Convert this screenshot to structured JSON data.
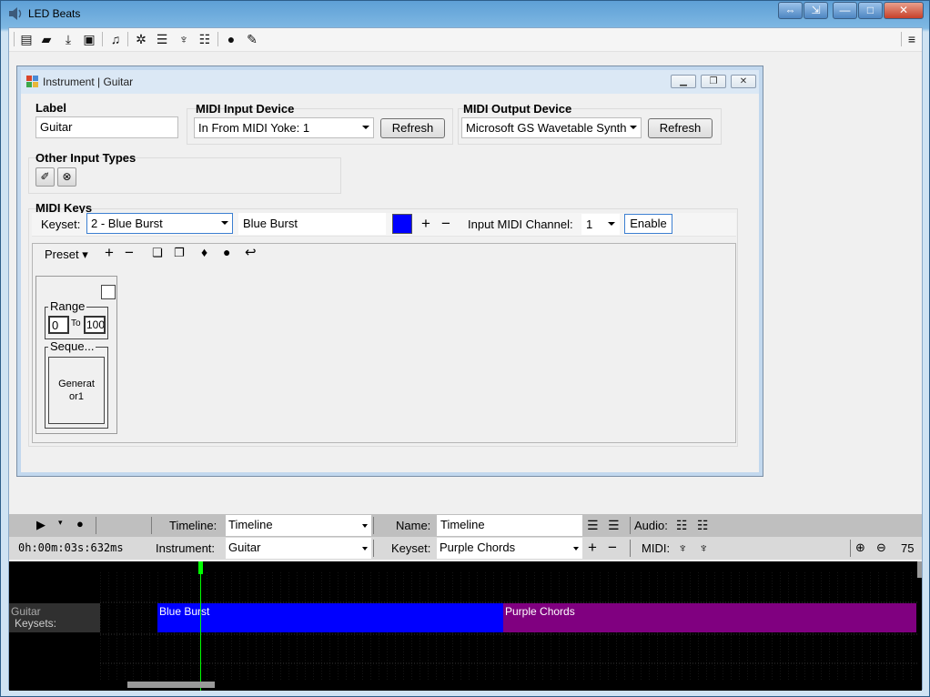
{
  "app": {
    "title": "LED Beats"
  },
  "window_buttons": [
    "⇔",
    "⇲",
    "—",
    "□",
    "✕"
  ],
  "toolbar": {
    "icons": [
      "new-file-icon",
      "open-folder-icon",
      "download-icon",
      "save-icon",
      "music-note-icon",
      "gear-icon",
      "sliders-icon",
      "figure-icon",
      "search-list-icon",
      "lightbulb-icon",
      "pencil-icon"
    ],
    "right_icon": "settings-list-icon"
  },
  "instrument_window": {
    "title": "Instrument | Guitar",
    "label": {
      "heading": "Label",
      "value": "Guitar"
    },
    "midi_input": {
      "heading": "MIDI Input Device",
      "value": "In From MIDI Yoke:  1",
      "refresh": "Refresh"
    },
    "midi_output": {
      "heading": "MIDI Output Device",
      "value": "Microsoft GS Wavetable Synth",
      "refresh": "Refresh"
    },
    "other_inputs": {
      "heading": "Other Input Types"
    },
    "midi_keys": {
      "heading": "MIDI Keys",
      "keyset_label": "Keyset:",
      "keyset_value": "2 - Blue Burst",
      "keyset_name": "Blue Burst",
      "keyset_color": "#0000ff",
      "channel_label": "Input MIDI Channel:",
      "channel_value": "1",
      "enable": "Enable",
      "preset": "Preset",
      "card": {
        "range_label": "Range",
        "range_from": "0",
        "range_to_label": "To",
        "range_to": "100",
        "sequence_label": "Seque...",
        "generator": "Generat or1"
      }
    }
  },
  "bottom": {
    "timeline_label": "Timeline:",
    "timeline_value": "Timeline",
    "name_label": "Name:",
    "name_value": "Timeline",
    "audio_label": "Audio:",
    "time": "0h:00m:03s:632ms",
    "instrument_label": "Instrument:",
    "instrument_value": "Guitar",
    "keyset_label": "Keyset:",
    "keyset_value": "Purple Chords",
    "midi_label": "MIDI:",
    "zoom": "75",
    "track_label_1": "Guitar",
    "track_label_2": "Keysets:",
    "clips": [
      {
        "label": "Blue Burst",
        "color": "#0000ff"
      },
      {
        "label": "Purple Chords",
        "color": "#800080"
      }
    ]
  },
  "colors": {
    "playhead": "#00ff00",
    "timeline_bg": "#000000",
    "bar_bg": "#bfbfbf"
  }
}
